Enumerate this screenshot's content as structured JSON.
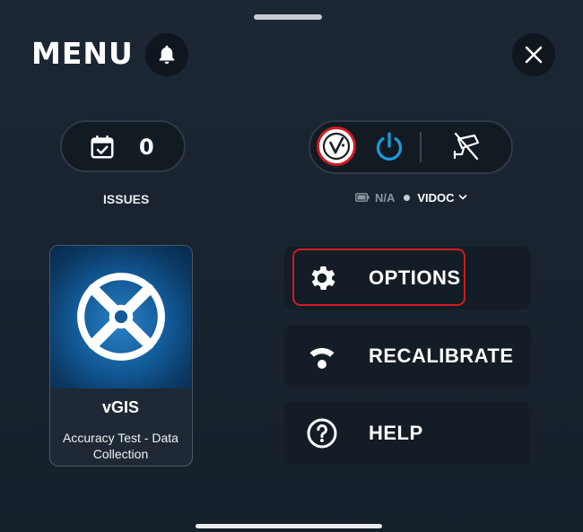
{
  "header": {
    "title": "MENU",
    "bell_icon": "bell-icon",
    "close_icon": "close-icon"
  },
  "issues": {
    "count": "0",
    "label": "ISSUES",
    "icon": "calendar-check-icon"
  },
  "device": {
    "logo_icon": "vidoc-logo-icon",
    "power_icon": "power-icon",
    "camera_icon": "camera-off-icon",
    "battery_text": "N/A",
    "device_name": "VIDOC",
    "accent_color": "#1a9be0",
    "logo_ring_color": "#d11b24"
  },
  "project_card": {
    "title": "vGIS",
    "subtitle": "Accuracy Test - Data Collection"
  },
  "menu_items": [
    {
      "label": "OPTIONS",
      "icon": "gear-icon",
      "highlighted": true
    },
    {
      "label": "RECALIBRATE",
      "icon": "wifi-signal-icon",
      "highlighted": false
    },
    {
      "label": "HELP",
      "icon": "help-circle-icon",
      "highlighted": false
    }
  ],
  "colors": {
    "background": "#1a2430",
    "highlight": "#d11b24"
  }
}
